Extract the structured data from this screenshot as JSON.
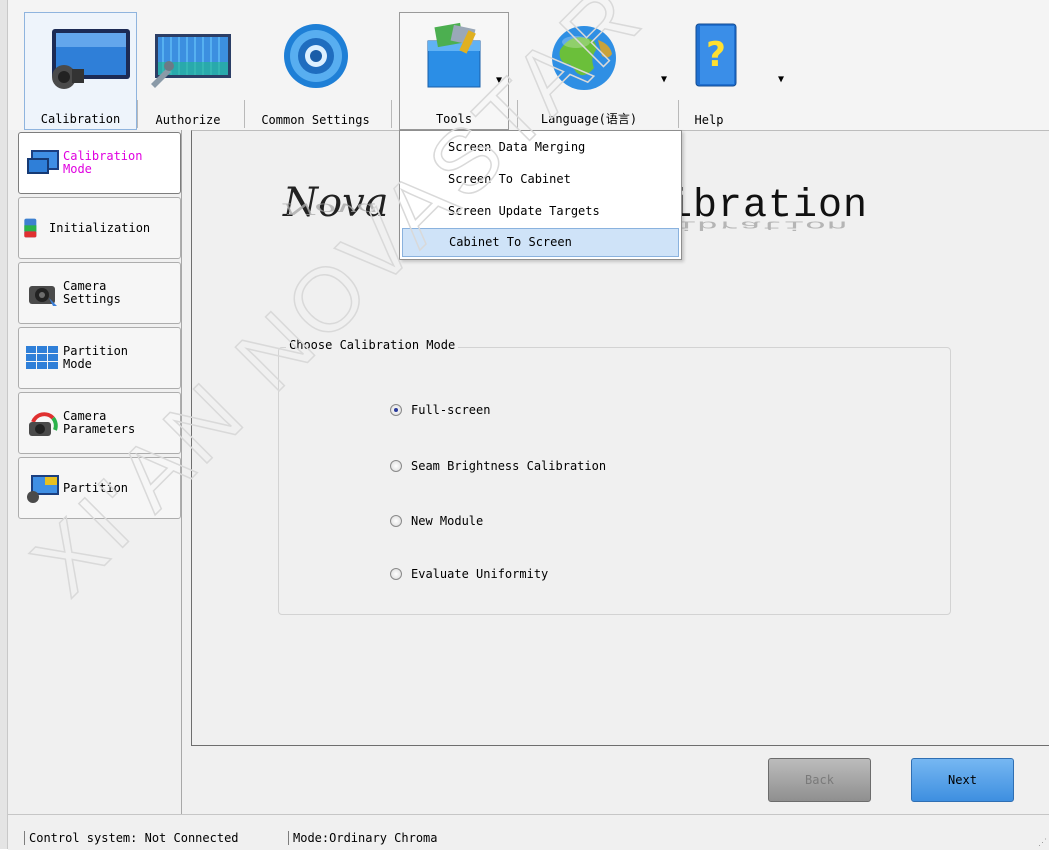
{
  "toolbar": {
    "calibration": "Calibration",
    "authorize": "Authorize",
    "common_settings": "Common Settings",
    "tools": "Tools",
    "language": "Language(语言)",
    "help": "Help"
  },
  "tools_menu": {
    "items": [
      "Screen Data Merging",
      "Screen To Cabinet",
      "Screen Update Targets",
      "Cabinet To Screen"
    ],
    "highlighted": "Cabinet To Screen"
  },
  "sidebar": {
    "items": [
      {
        "label": "Calibration\nMode",
        "active": true,
        "color": "#e000e0"
      },
      {
        "label": "Initialization",
        "active": false
      },
      {
        "label": "Camera\nSettings",
        "active": false
      },
      {
        "label": "Partition\nMode",
        "active": false
      },
      {
        "label": "Camera\nParameters",
        "active": false
      },
      {
        "label": "Partition",
        "active": false
      }
    ]
  },
  "banner": {
    "left": "Nova",
    "right": "ibration"
  },
  "mode_group": {
    "title": "Choose Calibration Mode",
    "options": [
      "Full-screen",
      "Seam Brightness Calibration",
      "New Module",
      "Evaluate Uniformity"
    ],
    "selected": "Full-screen"
  },
  "buttons": {
    "back": "Back",
    "next": "Next"
  },
  "status": {
    "control": "Control system: Not Connected",
    "mode": "Mode:Ordinary Chroma"
  },
  "watermark": "XI'AN NOVASTAR",
  "colors": {
    "active_label": "#e000e0",
    "next_button": "#3e8fe0",
    "menu_highlight": "#cfe3f8"
  }
}
